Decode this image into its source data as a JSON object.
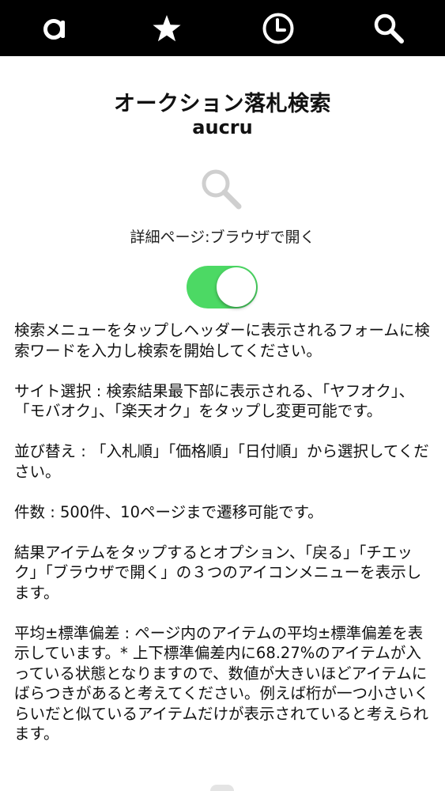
{
  "toolbar": {
    "icons": [
      "a-logo-icon",
      "star-icon",
      "clock-icon",
      "search-icon"
    ],
    "background": "#000000",
    "icon_color": "#ffffff"
  },
  "header": {
    "title": "オークション落札検索",
    "subtitle": "aucru"
  },
  "detail_page": {
    "label": "詳細ページ:ブラウザで開く",
    "toggle_on": true,
    "toggle_color": "#4cd964"
  },
  "description": [
    "検索メニューをタップしヘッダーに表示されるフォームに検索ワードを入力し検索を開始してください。",
    "サイト選択 : 検索結果最下部に表示される、「ヤフオク」、「モバオク」、「楽天オク」をタップし変更可能です。",
    "並び替え : 「入札順」「価格順」「日付順」から選択してください。",
    "件数 : 500件、10ページまで遷移可能です。",
    "結果アイテムをタップするとオプション、「戻る」「チエック」「ブラウザで開く」の３つのアイコンメニューを表示します。",
    "平均±標準偏差 : ページ内のアイテムの平均±標準偏差を表示しています。* 上下標準偏差内に68.27%のアイテムが入っている状態となりますので、数値が大きいほどアイテムにばらつきがあると考えてください。例えば桁が一つ小さいくらいだと似ているアイテムだけが表示されていると考えられます。"
  ]
}
